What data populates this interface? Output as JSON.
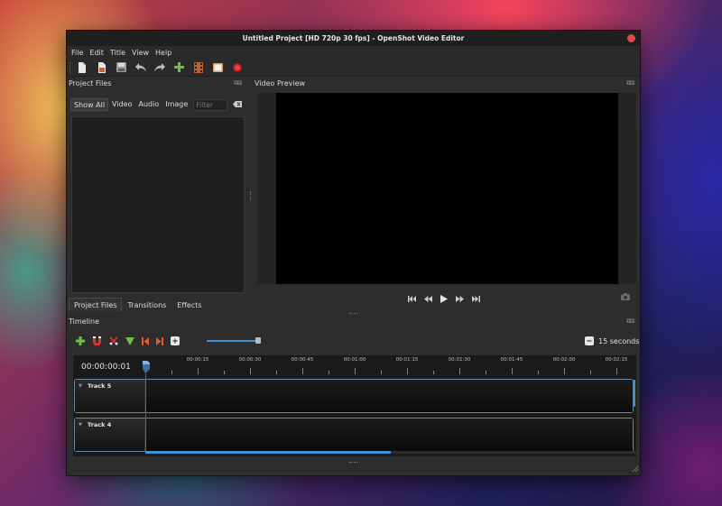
{
  "window": {
    "title": "Untitled Project [HD 720p 30 fps] - OpenShot Video Editor"
  },
  "menu": [
    "File",
    "Edit",
    "Title",
    "View",
    "Help"
  ],
  "toolbar_icons": [
    "new-project-icon",
    "open-project-icon",
    "save-project-icon",
    "undo-icon",
    "redo-icon",
    "import-files-icon",
    "choose-profile-icon",
    "fullscreen-icon",
    "export-video-icon"
  ],
  "project_files": {
    "title": "Project Files",
    "filters": [
      "Show All",
      "Video",
      "Audio",
      "Image"
    ],
    "filter_placeholder": "Filter",
    "tabs": [
      "Project Files",
      "Transitions",
      "Effects"
    ]
  },
  "video_preview": {
    "title": "Video Preview"
  },
  "timeline": {
    "title": "Timeline",
    "current_time": "00:00:00:01",
    "zoom_label": "15 seconds",
    "zoom_level": 0.98,
    "ruler_labels": [
      "00:00:15",
      "00:00:30",
      "00:00:45",
      "00:01:00",
      "00:01:15",
      "00:01:30",
      "00:01:45",
      "00:02:00",
      "00:02:15"
    ],
    "tracks": [
      {
        "name": "Track 5"
      },
      {
        "name": "Track 4"
      }
    ],
    "h_scroll_fraction": 0.5
  },
  "colors": {
    "accent": "#3d8fd6",
    "playhead": "#e03030",
    "window_bg": "#2d2d2d"
  }
}
